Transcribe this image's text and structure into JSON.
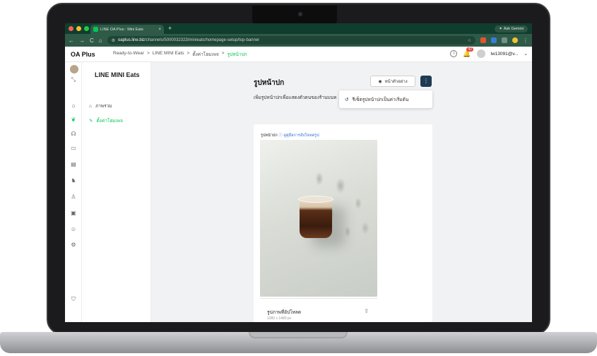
{
  "browser": {
    "tab_title": "LINE OA Plus : Mini Eats",
    "tab_close": "×",
    "new_tab": "+",
    "gemini_label": "Ask Gemini",
    "url_host": "oaplus.line.biz",
    "url_path": "/channels/5000032323/minieats/homepage-setup/top-banner",
    "nav_back": "←",
    "nav_forward": "→",
    "nav_reload": "C",
    "nav_home": "⌂"
  },
  "app": {
    "brand": "OA Plus",
    "breadcrumbs": [
      "Ready-to-Wear",
      ">",
      "LINE MINI Eats",
      ">",
      "ตั้งค่าโฮมเพจ",
      ">",
      "รูปหน้าปก"
    ],
    "notification_count": "42",
    "user_name": "lw13091@v...",
    "user_caret": "⌄"
  },
  "sidenav": {
    "title": "LINE MINI Eats",
    "items": [
      {
        "label": "ภาพรวม",
        "active": false
      },
      {
        "label": "ตั้งค่าโฮมเพจ",
        "active": true
      }
    ]
  },
  "page": {
    "title": "รูปหน้าปก",
    "description": "เพิ่มรูปหน้าปกเพื่อแสดงตัวตนของร้านบนห",
    "preview_button": "หน้าตัวอย่าง",
    "more_button": "⋮",
    "menu_item": "รีเซ็ตรูปหน้าปกเป็นค่าเริ่มต้น",
    "card_label": "รูปหน้าปก",
    "card_link": "ดูคู่มือการอัปโหลดรูป",
    "upload_title": "รูปภาพที่อัปโหลด",
    "upload_size": "1080 x 1480 px"
  },
  "colors": {
    "accent": "#06c755",
    "browser_frame": "#0f3d2e",
    "primary_dark": "#1f3b54",
    "link": "#2c6fd6",
    "badge": "#e54848"
  }
}
